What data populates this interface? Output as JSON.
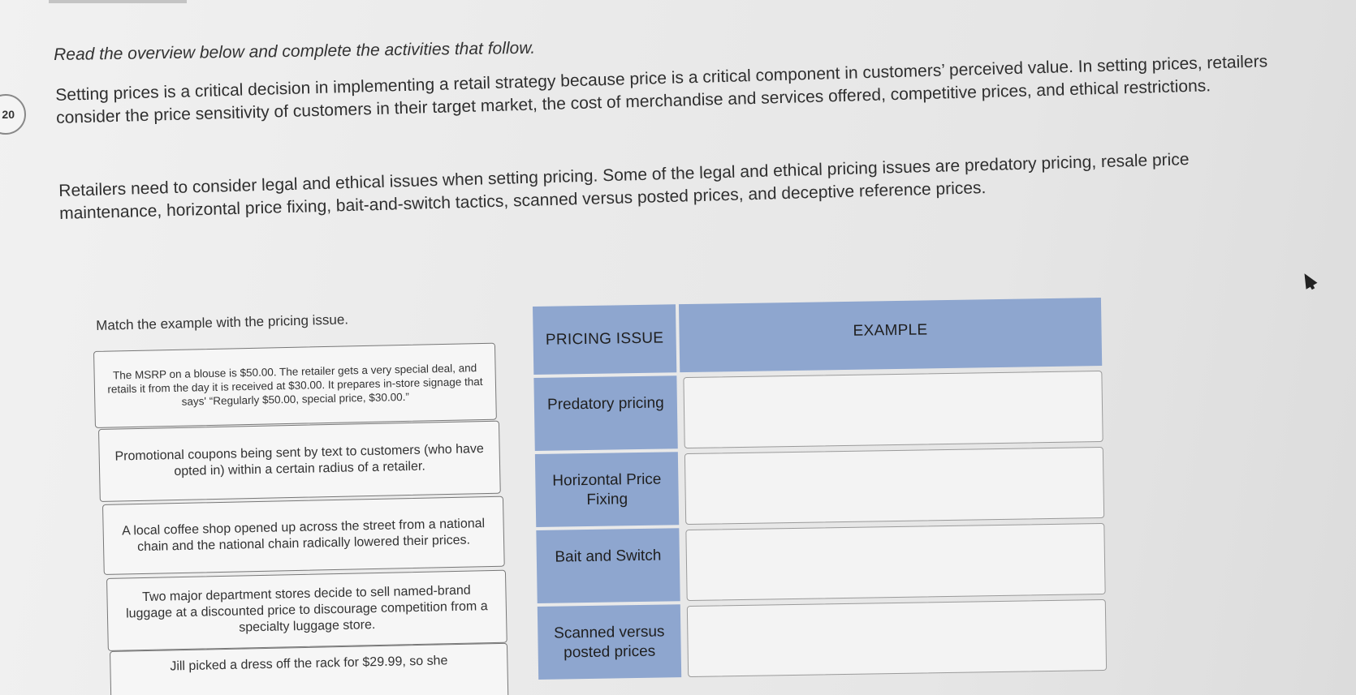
{
  "question_number": "20",
  "heading": "Read the overview below and complete the activities that follow.",
  "overview": {
    "paragraph1": "Setting prices is a critical decision in implementing a retail strategy because price is a critical component in customers’ perceived value. In setting prices, retailers consider the price sensitivity of customers in their target market, the cost of merchandise and services offered, competitive prices, and ethical restrictions.",
    "paragraph2": "Retailers need to consider legal and ethical issues when setting pricing. Some of the legal and ethical pricing issues are predatory pricing, resale price maintenance, horizontal price fixing, bait-and-switch tactics, scanned versus posted prices, and deceptive reference prices."
  },
  "activity": {
    "instruction": "Match the example with the pricing issue.",
    "examples": [
      "The MSRP on a blouse is $50.00. The retailer gets a very special deal, and retails it from the day it is received at $30.00. It prepares in-store signage that says' “Regularly $50.00, special price, $30.00.”",
      "Promotional coupons being sent by text to customers (who have opted in) within a certain radius of a retailer.",
      "A local coffee shop opened up across the street from a national chain and the national chain radically lowered their prices.",
      "Two major department stores decide to sell named-brand luggage at a discounted price to discourage competition from a specialty luggage store.",
      "Jill picked a dress off the rack for $29.99, so she"
    ],
    "table": {
      "header_issue": "PRICING ISSUE",
      "header_example": "EXAMPLE",
      "issues": [
        "Predatory pricing",
        "Horizontal Price Fixing",
        "Bait and Switch",
        "Scanned versus posted prices"
      ]
    }
  },
  "colors": {
    "table_blue": "#8ea6cf",
    "card_border": "#777777"
  }
}
